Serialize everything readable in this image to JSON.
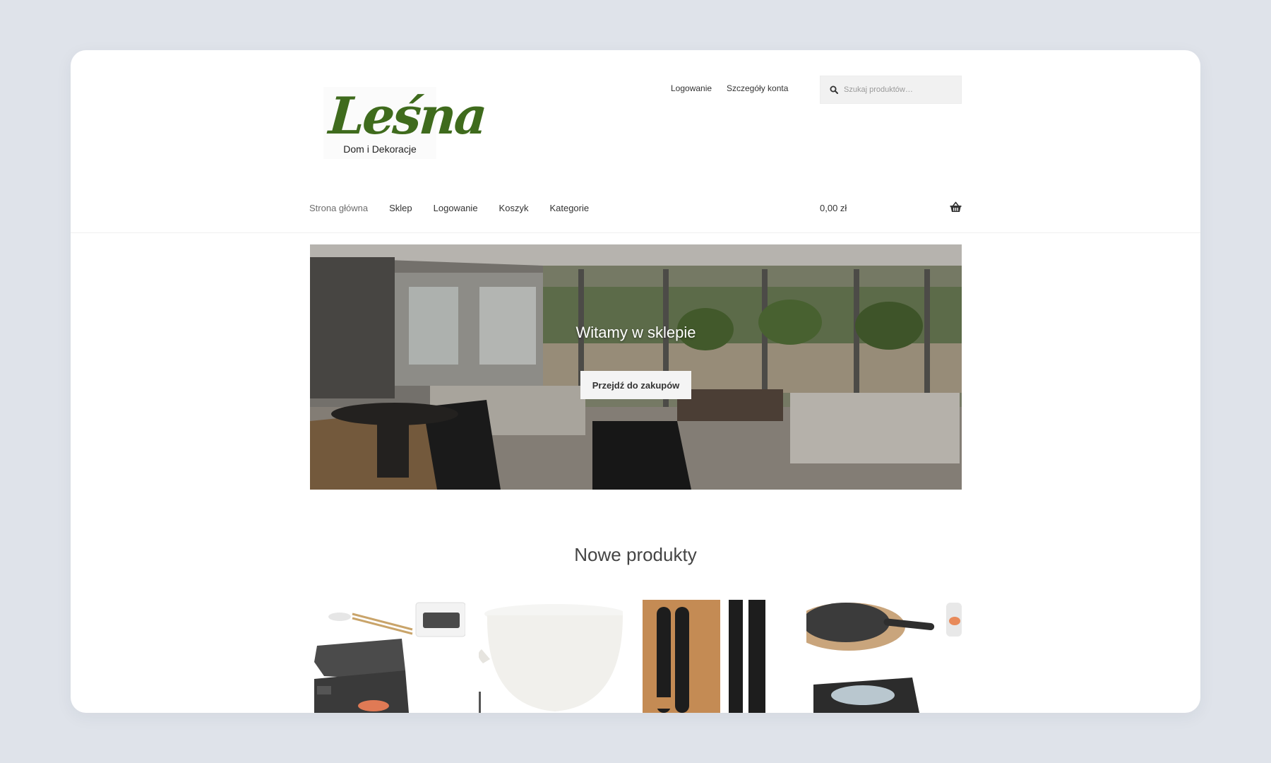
{
  "logo": {
    "wordmark": "Leśna",
    "tagline": "Dom i Dekoracje"
  },
  "top_links": {
    "login": "Logowanie",
    "account": "Szczegóły konta"
  },
  "search": {
    "placeholder": "Szukaj produktów…",
    "icon": "search-icon"
  },
  "nav": {
    "items": [
      {
        "label": "Strona główna",
        "active": true
      },
      {
        "label": "Sklep"
      },
      {
        "label": "Logowanie"
      },
      {
        "label": "Koszyk"
      },
      {
        "label": "Kategorie"
      }
    ]
  },
  "cart": {
    "total": "0,00 zł",
    "icon": "basket-icon"
  },
  "hero": {
    "title": "Witamy w sklepie",
    "button_label": "Przejdź do zakupów"
  },
  "section": {
    "title": "Nowe produkty"
  },
  "colors": {
    "page_bg": "#dfe3ea",
    "card_bg": "#ffffff",
    "logo_green": "#3f6b1d",
    "search_bg": "#f1f1f1"
  }
}
